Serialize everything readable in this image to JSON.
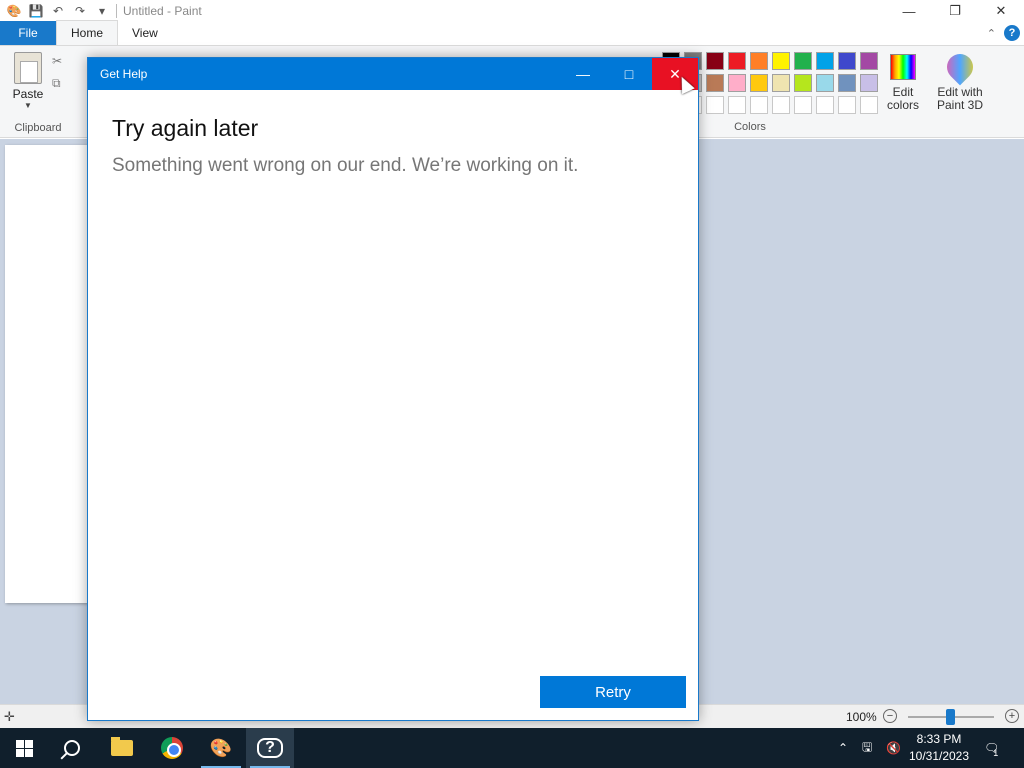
{
  "paint": {
    "title": "Untitled - Paint",
    "tabs": {
      "file": "File",
      "home": "Home",
      "view": "View"
    },
    "clipboard": {
      "paste_label": "Paste",
      "group_label": "Clipboard"
    },
    "colors": {
      "group_label": "Colors",
      "edit_colors_label": "Edit colors",
      "edit_with_paint3d_label": "Edit with Paint 3D",
      "row1": [
        "#000000",
        "#7f7f7f",
        "#880015",
        "#ed1c24",
        "#ff7f27",
        "#fff200",
        "#22b14c",
        "#00a2e8",
        "#3f48cc",
        "#a349a4"
      ],
      "row2": [
        "#ffffff",
        "#c3c3c3",
        "#b97a57",
        "#ffaec9",
        "#ffc90e",
        "#efe4b0",
        "#b5e61d",
        "#99d9ea",
        "#7092be",
        "#c8bfe7"
      ]
    },
    "status": {
      "zoom": "100%"
    }
  },
  "dialog": {
    "title": "Get Help",
    "heading": "Try again later",
    "message": "Something went wrong on our end. We’re working on it.",
    "retry_label": "Retry"
  },
  "taskbar": {
    "time": "8:33 PM",
    "date": "10/31/2023",
    "notification_count": "1"
  },
  "icons": {
    "minimize": "minimize-icon",
    "maximize": "maximize-icon",
    "close": "close-icon"
  }
}
